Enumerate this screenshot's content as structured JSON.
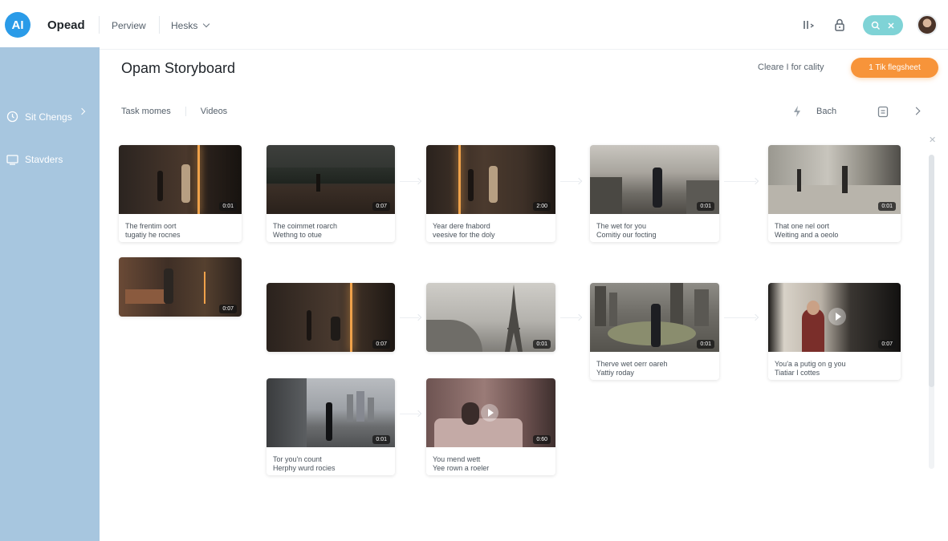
{
  "app": {
    "logo": "AI",
    "name": "Opead"
  },
  "nav": {
    "item1": "Perview",
    "item2": "Hesks"
  },
  "toolbar_icons": [
    "columns-icon",
    "lock-icon",
    "search-icon",
    "close-icon",
    "avatar"
  ],
  "sidebar": {
    "items": [
      {
        "label": "Sit Chengs",
        "icon": "clock-icon"
      },
      {
        "label": "Stavders",
        "icon": "monitor-icon"
      }
    ]
  },
  "page": {
    "title": "Opam Storyboard",
    "secondary_action": "Cleare I for cality",
    "primary_action": "1  Tik flegsheet"
  },
  "tabs": [
    "Task momes",
    "Videos"
  ],
  "filter": {
    "label": "Bach"
  },
  "colors": {
    "accent": "#f7943a",
    "sidebar": "#a7c6df",
    "logo": "#2a9be8",
    "search_pill": "#7fd3d6"
  },
  "cards": [
    {
      "duration": "0:01",
      "line1": "The frentim oort",
      "line2": "tugatiy he rocnes"
    },
    {
      "duration": "0:07",
      "line1": "The coimmet roarch",
      "line2": "Wethng to otue"
    },
    {
      "duration": "2:00",
      "line1": "Year dere fnabord",
      "line2": "veesive for the doly"
    },
    {
      "duration": "0:01",
      "line1": "The wet for you",
      "line2": "Comitiy our focting"
    },
    {
      "duration": "0:01",
      "line1": "That one nel oort",
      "line2": "Weiting and a oeolo"
    },
    {
      "duration": "0:07"
    },
    {
      "duration": "0:07"
    },
    {
      "duration": "0:01"
    },
    {
      "duration": "0:01",
      "line1": "Therve wet oerr oareh",
      "line2": "Yattiy roday"
    },
    {
      "duration": "0:07",
      "line1": "You'a a putig on g you",
      "line2": "Tiatiar I cottes"
    },
    {
      "duration": "0:01",
      "line1": "Tor you'n count",
      "line2": "Herphy wurd rocies"
    },
    {
      "duration": "0:60",
      "line1": "You mend wett",
      "line2": "Yee rown a roeler"
    }
  ]
}
